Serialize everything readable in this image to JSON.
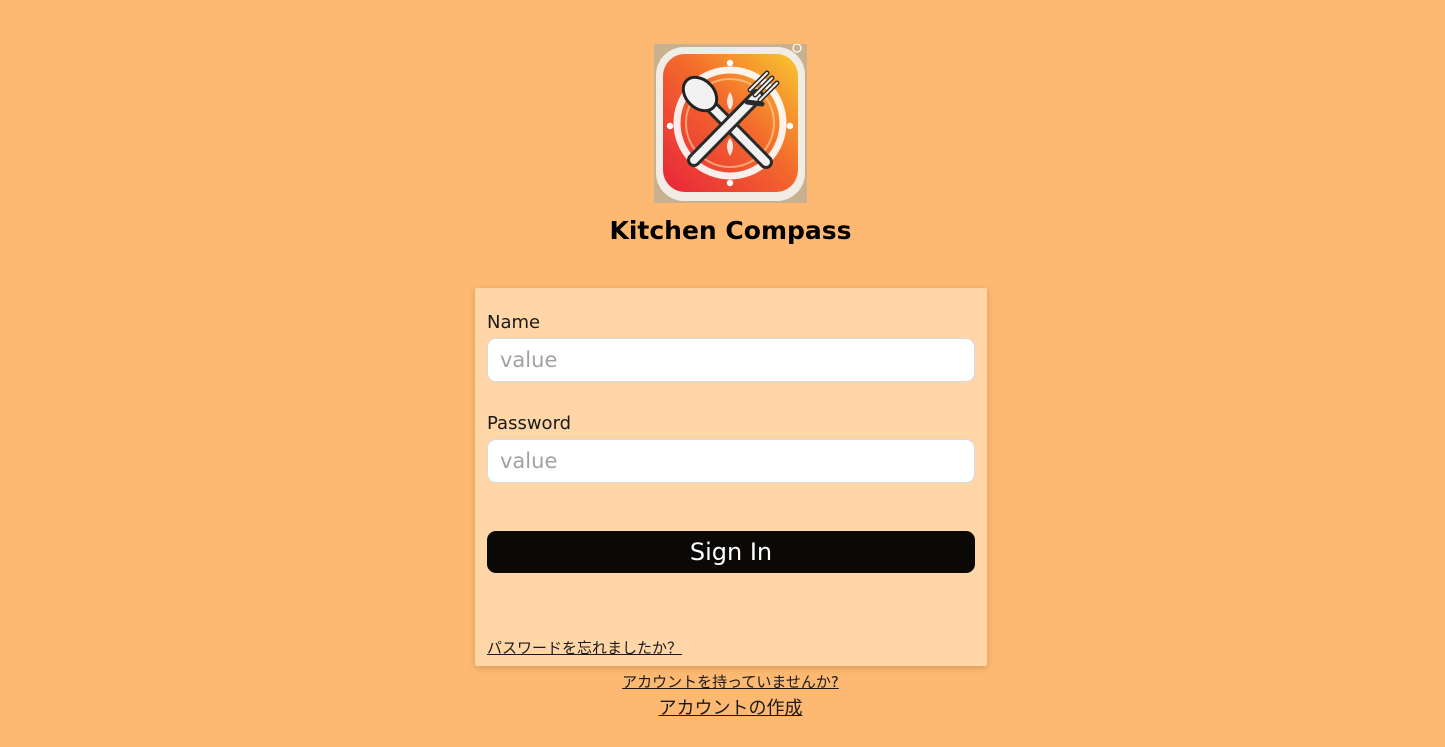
{
  "app": {
    "logo_icon": "crossed-spoon-fork-icon",
    "title": "Kitchen Compass"
  },
  "login_form": {
    "name_label": "Name",
    "name_placeholder": "value",
    "name_value": "",
    "password_label": "Password",
    "password_placeholder": "value",
    "password_value": "",
    "sign_in_label": "Sign In",
    "forgot_password": "パスワードを忘れましたか？"
  },
  "footer": {
    "no_account": "アカウントを持っていませんか?",
    "create_account": "アカウントの作成"
  },
  "colors": {
    "background": "#fdb871",
    "card": "#fed6a8",
    "button": "#0b0907",
    "button_text": "#ffffff"
  }
}
